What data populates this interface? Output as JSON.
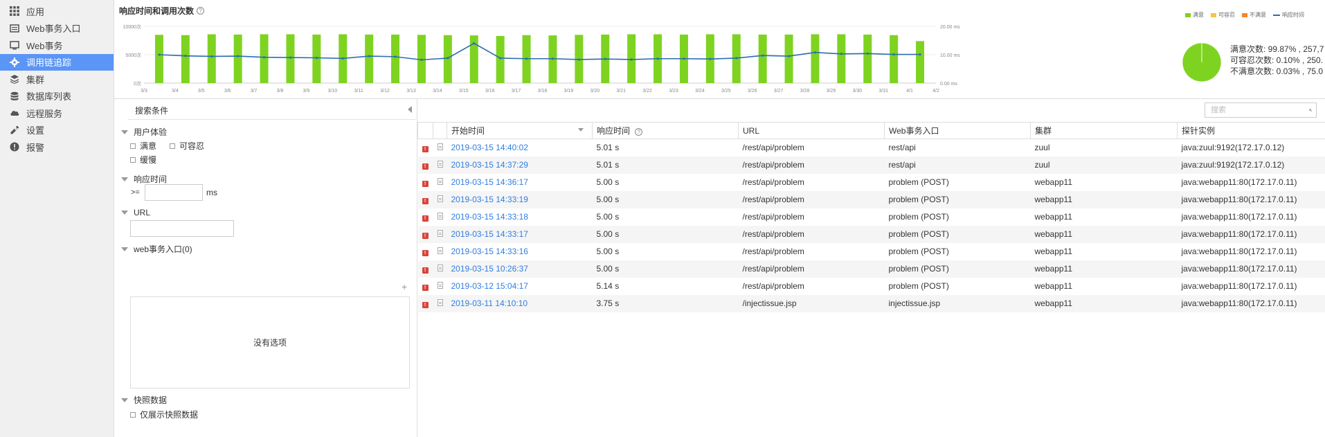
{
  "sidebar": {
    "items": [
      {
        "label": "应用",
        "icon": "grid-icon",
        "active": false
      },
      {
        "label": "Web事务入口",
        "icon": "list-icon",
        "active": false
      },
      {
        "label": "Web事务",
        "icon": "monitor-icon",
        "active": false
      },
      {
        "label": "调用链追踪",
        "icon": "gear-icon",
        "active": true
      },
      {
        "label": "集群",
        "icon": "layers-icon",
        "active": false
      },
      {
        "label": "数据库列表",
        "icon": "database-icon",
        "active": false
      },
      {
        "label": "远程服务",
        "icon": "cloud-icon",
        "active": false
      },
      {
        "label": "设置",
        "icon": "wrench-icon",
        "active": false
      },
      {
        "label": "报警",
        "icon": "alert-icon",
        "active": false
      }
    ]
  },
  "chart": {
    "title": "响应时间和调用次数",
    "legend": [
      "满意",
      "可容忍",
      "不满意",
      "响应时间"
    ],
    "pie_stats": [
      "满意次数: 99.87% , 257,7",
      "可容忍次数: 0.10% , 250.",
      "不满意次数: 0.03% , 75.0"
    ]
  },
  "chart_data": {
    "type": "bar",
    "categories": [
      "3/3",
      "3/4",
      "3/5",
      "3/6",
      "3/7",
      "3/8",
      "3/9",
      "3/10",
      "3/11",
      "3/12",
      "3/13",
      "3/14",
      "3/15",
      "3/16",
      "3/17",
      "3/18",
      "3/19",
      "3/20",
      "3/21",
      "3/22",
      "3/23",
      "3/24",
      "3/25",
      "3/26",
      "3/27",
      "3/28",
      "3/29",
      "3/30",
      "3/31",
      "4/1",
      "4/2"
    ],
    "series": [
      {
        "name": "满意",
        "type": "bar",
        "axis": "left",
        "values": [
          8500,
          8450,
          8600,
          8550,
          8600,
          8600,
          8550,
          8600,
          8550,
          8550,
          8500,
          8450,
          8400,
          8300,
          8450,
          8400,
          8500,
          8550,
          8600,
          8600,
          8550,
          8600,
          8600,
          8550,
          8550,
          8600,
          8600,
          8550,
          8450,
          7400
        ]
      },
      {
        "name": "响应时间",
        "type": "line",
        "axis": "right",
        "values": [
          10.0,
          9.6,
          9.4,
          9.5,
          9.1,
          9.0,
          8.9,
          8.7,
          9.5,
          9.3,
          8.2,
          8.8,
          14.0,
          8.8,
          8.6,
          8.6,
          8.3,
          8.5,
          8.3,
          8.6,
          8.6,
          8.5,
          8.8,
          9.7,
          9.5,
          10.8,
          10.3,
          10.4,
          10.1,
          10.1
        ]
      }
    ],
    "yleft": {
      "ticks": [
        "0次",
        "5000次",
        "10000次"
      ],
      "range": [
        0,
        10000
      ]
    },
    "yright": {
      "ticks": [
        "0.00 ms",
        "10.00 ms",
        "20.00 ms"
      ],
      "range": [
        0,
        20
      ]
    },
    "pie": [
      {
        "name": "满意",
        "value": 99.87
      },
      {
        "name": "可容忍",
        "value": 0.1
      },
      {
        "name": "不满意",
        "value": 0.03
      }
    ]
  },
  "colors": {
    "bar": "#7ed321",
    "line": "#2a6db0",
    "accent": "#5b95f5",
    "link": "#2f7de0",
    "tolerate": "#f5c542",
    "frustrated": "#f5872a"
  },
  "filter": {
    "title": "搜索条件",
    "ux_title": "用户体验",
    "ux_options": [
      "满意",
      "可容忍",
      "缓慢"
    ],
    "rt_title": "响应时间",
    "rt_prefix": ">=",
    "rt_unit": "ms",
    "url_title": "URL",
    "entry_title": "web事务入口(0)",
    "plus": "+",
    "no_options": "没有选项",
    "snapshot_title": "快照数据",
    "snapshot_option": "仅展示快照数据"
  },
  "table": {
    "search_placeholder": "搜索",
    "columns": [
      "开始时间",
      "响应时间",
      "URL",
      "Web事务入口",
      "集群",
      "探针实例"
    ],
    "rows": [
      [
        "2019-03-15 14:40:02",
        "5.01 s",
        "/rest/api/problem",
        "rest/api",
        "zuul",
        "java:zuul:9192(172.17.0.12)"
      ],
      [
        "2019-03-15 14:37:29",
        "5.01 s",
        "/rest/api/problem",
        "rest/api",
        "zuul",
        "java:zuul:9192(172.17.0.12)"
      ],
      [
        "2019-03-15 14:36:17",
        "5.00 s",
        "/rest/api/problem",
        "problem (POST)",
        "webapp11",
        "java:webapp11:80(172.17.0.11)"
      ],
      [
        "2019-03-15 14:33:19",
        "5.00 s",
        "/rest/api/problem",
        "problem (POST)",
        "webapp11",
        "java:webapp11:80(172.17.0.11)"
      ],
      [
        "2019-03-15 14:33:18",
        "5.00 s",
        "/rest/api/problem",
        "problem (POST)",
        "webapp11",
        "java:webapp11:80(172.17.0.11)"
      ],
      [
        "2019-03-15 14:33:17",
        "5.00 s",
        "/rest/api/problem",
        "problem (POST)",
        "webapp11",
        "java:webapp11:80(172.17.0.11)"
      ],
      [
        "2019-03-15 14:33:16",
        "5.00 s",
        "/rest/api/problem",
        "problem (POST)",
        "webapp11",
        "java:webapp11:80(172.17.0.11)"
      ],
      [
        "2019-03-15 10:26:37",
        "5.00 s",
        "/rest/api/problem",
        "problem (POST)",
        "webapp11",
        "java:webapp11:80(172.17.0.11)"
      ],
      [
        "2019-03-12 15:04:17",
        "5.14 s",
        "/rest/api/problem",
        "problem (POST)",
        "webapp11",
        "java:webapp11:80(172.17.0.11)"
      ],
      [
        "2019-03-11 14:10:10",
        "3.75 s",
        "/injectissue.jsp",
        "injectissue.jsp",
        "webapp11",
        "java:webapp11:80(172.17.0.11)"
      ]
    ]
  }
}
